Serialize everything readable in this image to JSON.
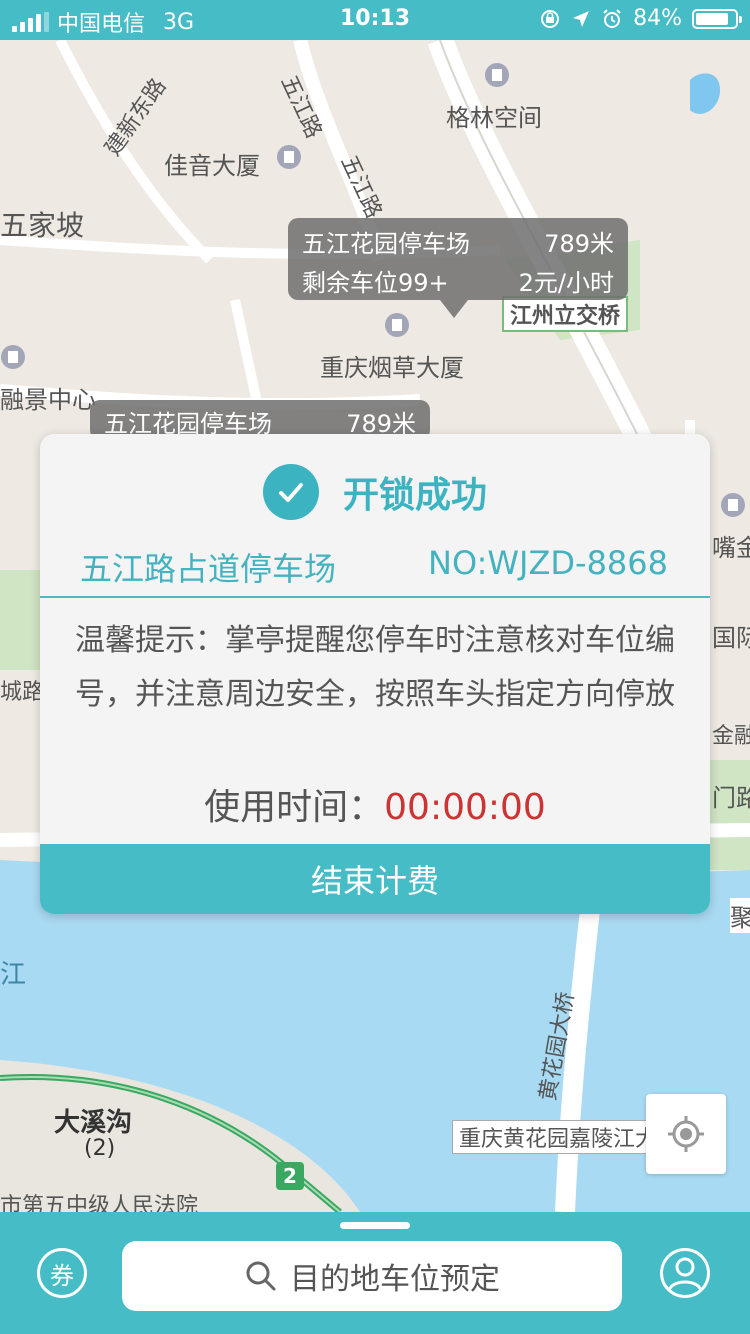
{
  "status_bar": {
    "carrier": "中国电信",
    "network": "3G",
    "time": "10:13",
    "battery_percent": "84%",
    "battery_level": 0.84
  },
  "map": {
    "labels": {
      "gelin": "格林空间",
      "jianxin": "建新东路",
      "wujiang_road_1": "五江路",
      "wujiang_road_2": "五江路",
      "jiayin": "佳音大厦",
      "wujiapo": "五家坡",
      "jiangzhou_overpass": "江州立交桥",
      "chongqing_tobacco": "重庆烟草大厦",
      "rongjing": "融景中心",
      "chengdu_road": "城路",
      "da_xi_gou": "大溪沟",
      "da_xi_gou_sub": "(2)",
      "court": "市第五中级人民法院",
      "huanghuayuan_bridge": "黄花园大桥",
      "jialing_bridge": "重庆黄花园嘉陵江大",
      "river_jiang": "江",
      "zuijin": "嘴金",
      "guoji": "国际",
      "jinrong": "金融",
      "menlu": "门路",
      "ju": "聚",
      "route_badge": "2"
    },
    "popup_main": {
      "name": "五江花园停车场",
      "distance": "789米",
      "spaces": "剩余车位99+",
      "price": "2元/小时"
    },
    "popup_secondary": {
      "name": "五江花园停车场",
      "distance": "789米"
    }
  },
  "dialog": {
    "title": "开锁成功",
    "lot_name": "五江路占道停车场",
    "lot_no": "NO:WJZD-8868",
    "tip": "温馨提示：掌亭提醒您停车时注意核对车位编号，并注意周边安全，按照车头指定方向停放",
    "usage_label": "使用时间：",
    "usage_time": "00:00:00",
    "end_button": "结束计费"
  },
  "bottom_bar": {
    "coupon_label": "券",
    "search_placeholder": "目的地车位预定"
  },
  "colors": {
    "accent": "#45bcc6",
    "timer": "#cc3333",
    "river": "#a9daf3",
    "park": "#cfe5c4"
  }
}
